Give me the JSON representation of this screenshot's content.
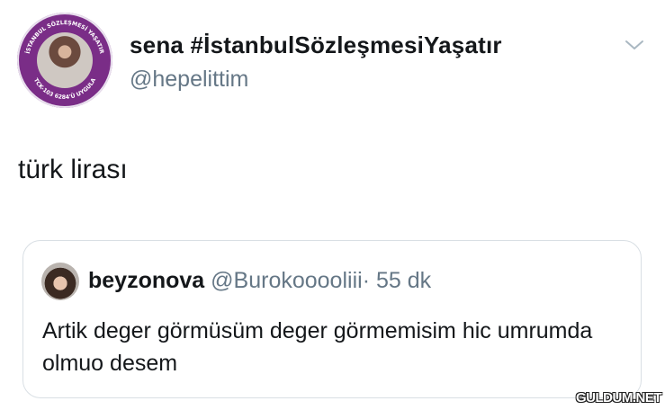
{
  "author": {
    "display_name": "sena #İstanbulSözleşmesiYaşatır",
    "handle": "@hepelittim",
    "avatar_badge": {
      "ring_text_top": "İSTANBUL SÖZLEŞMESİ YAŞATIR",
      "ring_text_bottom": "TCK-103 6284'Ü UYGULA"
    }
  },
  "tweet": {
    "text": "türk lirası"
  },
  "quoted_tweet": {
    "author_name": "beyzonova",
    "handle": "@Burokooooliii",
    "separator": "·",
    "time": "55 dk",
    "text": "Artik deger görmüsüm deger görmemisim hic umrumda olmuo desem"
  },
  "watermark": "GULDUM.NET",
  "icons": {
    "menu": "chevron-down-icon"
  },
  "colors": {
    "badge_purple": "#7a2d87",
    "secondary_text": "#657786",
    "border": "#d9dfe4"
  }
}
